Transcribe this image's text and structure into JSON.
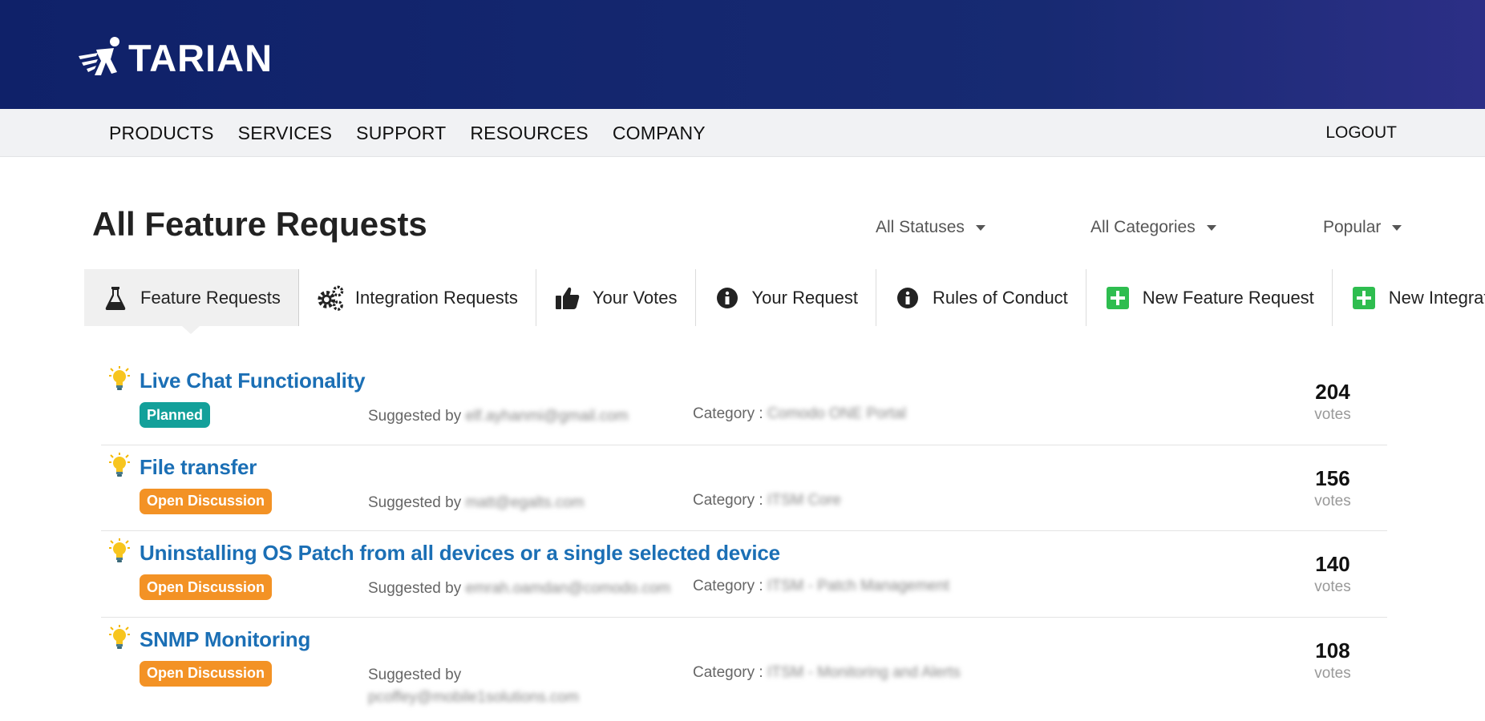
{
  "brand": {
    "logo_text": "TARIAN"
  },
  "nav": {
    "items": [
      "PRODUCTS",
      "SERVICES",
      "SUPPORT",
      "RESOURCES",
      "COMPANY"
    ],
    "logout": "LOGOUT"
  },
  "page": {
    "title": "All Feature Requests"
  },
  "filters": {
    "status": "All Statuses",
    "category": "All Categories",
    "sort": "Popular"
  },
  "tabs": [
    {
      "label": "Feature Requests",
      "icon": "flask-icon",
      "active": true
    },
    {
      "label": "Integration Requests",
      "icon": "gears-icon",
      "active": false
    },
    {
      "label": "Your Votes",
      "icon": "thumbs-up-icon",
      "active": false
    },
    {
      "label": "Your Request",
      "icon": "info-icon",
      "active": false
    },
    {
      "label": "Rules of Conduct",
      "icon": "info-icon",
      "active": false
    },
    {
      "label": "New Feature Request",
      "icon": "plus-square-icon",
      "active": false
    },
    {
      "label": "New Integration",
      "icon": "plus-square-icon",
      "active": false
    }
  ],
  "labels": {
    "suggested_by": "Suggested by",
    "category_prefix": "Category :",
    "votes": "votes"
  },
  "colors": {
    "header": "#0f2169",
    "link": "#1b6fb5",
    "planned": "#13a09a",
    "open_discussion": "#f39225",
    "plus": "#2ebd4f"
  },
  "requests": [
    {
      "title": "Live Chat Functionality",
      "status": "Planned",
      "suggested_by": "elf.ayhanmi@gmail.com",
      "category": "Comodo ONE Portal",
      "votes": "204"
    },
    {
      "title": "File transfer",
      "status": "Open Discussion",
      "suggested_by": "matt@egalts.com",
      "category": "ITSM Core",
      "votes": "156"
    },
    {
      "title": "Uninstalling OS Patch from all devices or a single selected device",
      "status": "Open Discussion",
      "suggested_by": "emrah.oamdan@comodo.com",
      "category": "ITSM - Patch Management",
      "votes": "140"
    },
    {
      "title": "SNMP Monitoring",
      "status": "Open Discussion",
      "suggested_by": "pcoffey@mobile1solutions.com",
      "category": "ITSM - Monitoring and Alerts",
      "votes": "108"
    }
  ]
}
